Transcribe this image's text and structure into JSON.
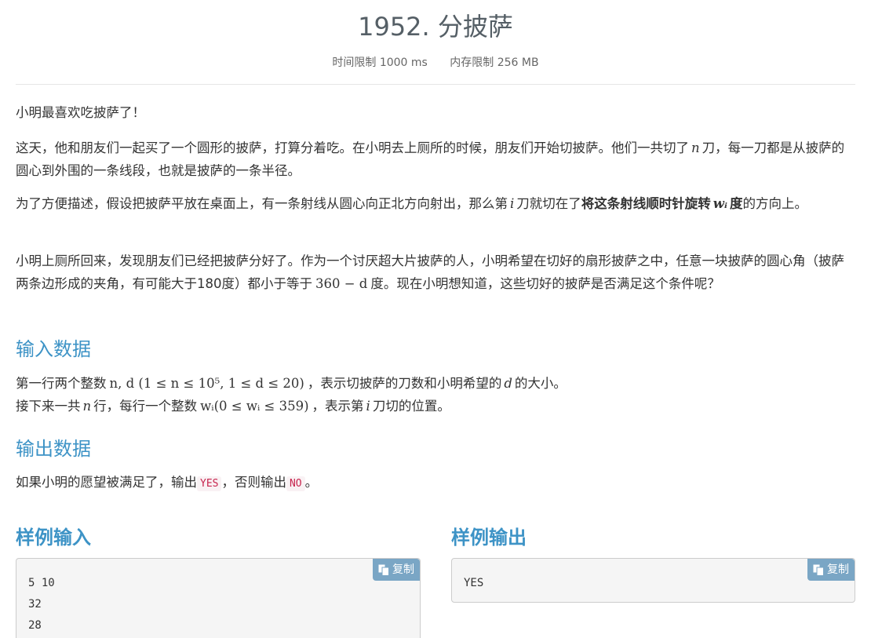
{
  "problem": {
    "title": "1952. 分披萨",
    "time_limit": "时间限制 1000 ms",
    "memory_limit": "内存限制 256 MB"
  },
  "description": {
    "p1": "小明最喜欢吃披萨了！",
    "p2_a": "这天，他和朋友们一起买了一个圆形的披萨，打算分着吃。在小明去上厕所的时候，朋友们开始切披萨。他们一共切了",
    "p2_var": "n",
    "p2_b": "刀，每一刀都是从披萨的圆心到外围的一条线段，也就是披萨的一条半径。",
    "p3_a": "为了方便描述，假设把披萨平放在桌面上，有一条射线从圆心向正北方向射出，那么第",
    "p3_var": "i",
    "p3_b": "刀就切在了",
    "p3_bold": "将这条射线顺时针旋转",
    "p3_bold_var": "wᵢ",
    "p3_bold_end": "度",
    "p3_c": "的方向上。",
    "p4_a": "小明上厕所回来，发现朋友们已经把披萨分好了。作为一个讨厌超大片披萨的人，小明希望在切好的扇形披萨之中，任意一块披萨的圆心角（披萨两条边形成的夹角，有可能大于180度）都小于等于",
    "p4_math": "360 − d",
    "p4_b": "度。现在小明想知道，这些切好的披萨是否满足这个条件呢？"
  },
  "input": {
    "heading": "输入数据",
    "line1_a": "第一行两个整数",
    "line1_math": "n, d (1 ≤ n ≤ 10⁵, 1 ≤ d ≤ 20)",
    "line1_b": "，表示切披萨的刀数和小明希望的",
    "line1_var": "d",
    "line1_c": "的大小。",
    "line2_a": "接下来一共",
    "line2_var": "n",
    "line2_b": "行，每行一个整数",
    "line2_math": "wᵢ(0 ≤ wᵢ ≤ 359)",
    "line2_c": "，表示第",
    "line2_var2": "i",
    "line2_d": "刀切的位置。"
  },
  "output": {
    "heading": "输出数据",
    "text_a": "如果小明的愿望被满足了，输出",
    "yes": "YES",
    "text_b": "，否则输出",
    "no": "NO",
    "text_c": "。"
  },
  "sample_input": {
    "heading": "样例输入",
    "copy_label": "复制",
    "content": "5 10\n32\n28"
  },
  "sample_output": {
    "heading": "样例输出",
    "copy_label": "复制",
    "content": "YES"
  },
  "colors": {
    "heading_blue": "#3d93c6",
    "copy_button": "#7aa6c5",
    "code_red": "#c7254e"
  }
}
